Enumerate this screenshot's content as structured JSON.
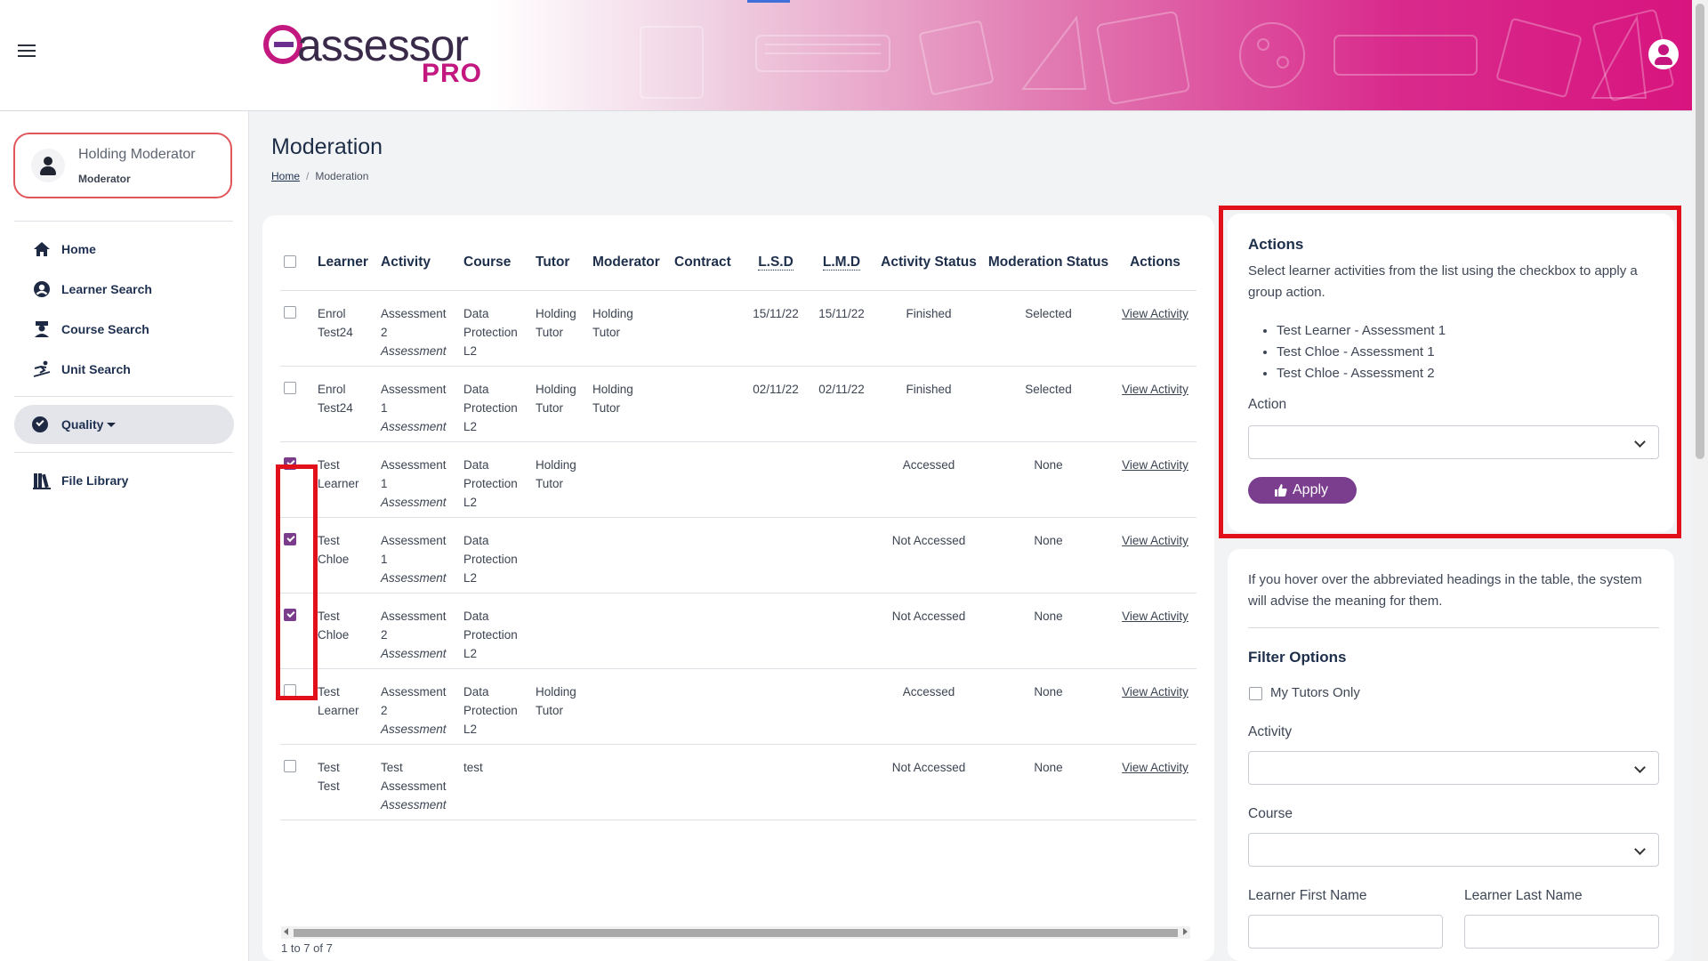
{
  "header": {
    "logo_main": "assessor",
    "logo_sub": "PRO"
  },
  "sidebar": {
    "profile": {
      "name": "Holding Moderator",
      "role": "Moderator"
    },
    "items": [
      {
        "label": "Home",
        "icon": "home-icon"
      },
      {
        "label": "Learner Search",
        "icon": "user-circle-icon"
      },
      {
        "label": "Course Search",
        "icon": "graduate-icon"
      },
      {
        "label": "Unit Search",
        "icon": "skier-icon"
      }
    ],
    "quality": {
      "label": "Quality",
      "icon": "check-circle-icon"
    },
    "file_library": {
      "label": "File Library",
      "icon": "books-icon"
    }
  },
  "page": {
    "title": "Moderation",
    "breadcrumb": {
      "home": "Home",
      "current": "Moderation"
    }
  },
  "table": {
    "headers": [
      "Learner",
      "Activity",
      "Course",
      "Tutor",
      "Moderator",
      "Contract",
      "L.S.D",
      "L.M.D",
      "Activity Status",
      "Moderation Status",
      "Actions"
    ],
    "rows": [
      {
        "checked": false,
        "learner": [
          "Enrol",
          "Test24"
        ],
        "activity": [
          "Assessment",
          "2"
        ],
        "activity_type": "Assessment",
        "course": [
          "Data",
          "Protection",
          "L2"
        ],
        "tutor": [
          "Holding",
          "Tutor"
        ],
        "moderator": [
          "Holding",
          "Tutor"
        ],
        "contract": "",
        "lsd": "15/11/22",
        "lmd": "15/11/22",
        "activity_status": "Finished",
        "moderation_status": "Selected",
        "action": "View Activity"
      },
      {
        "checked": false,
        "learner": [
          "Enrol",
          "Test24"
        ],
        "activity": [
          "Assessment",
          "1"
        ],
        "activity_type": "Assessment",
        "course": [
          "Data",
          "Protection",
          "L2"
        ],
        "tutor": [
          "Holding",
          "Tutor"
        ],
        "moderator": [
          "Holding",
          "Tutor"
        ],
        "contract": "",
        "lsd": "02/11/22",
        "lmd": "02/11/22",
        "activity_status": "Finished",
        "moderation_status": "Selected",
        "action": "View Activity"
      },
      {
        "checked": true,
        "learner": [
          "Test",
          "Learner"
        ],
        "activity": [
          "Assessment",
          "1"
        ],
        "activity_type": "Assessment",
        "course": [
          "Data",
          "Protection",
          "L2"
        ],
        "tutor": [
          "Holding",
          "Tutor"
        ],
        "moderator": [
          "",
          ""
        ],
        "contract": "",
        "lsd": "",
        "lmd": "",
        "activity_status": "Accessed",
        "moderation_status": "None",
        "action": "View Activity"
      },
      {
        "checked": true,
        "learner": [
          "Test",
          "Chloe"
        ],
        "activity": [
          "Assessment",
          "1"
        ],
        "activity_type": "Assessment",
        "course": [
          "Data",
          "Protection",
          "L2"
        ],
        "tutor": [
          "",
          ""
        ],
        "moderator": [
          "",
          ""
        ],
        "contract": "",
        "lsd": "",
        "lmd": "",
        "activity_status": "Not Accessed",
        "moderation_status": "None",
        "action": "View Activity"
      },
      {
        "checked": true,
        "learner": [
          "Test",
          "Chloe"
        ],
        "activity": [
          "Assessment",
          "2"
        ],
        "activity_type": "Assessment",
        "course": [
          "Data",
          "Protection",
          "L2"
        ],
        "tutor": [
          "",
          ""
        ],
        "moderator": [
          "",
          ""
        ],
        "contract": "",
        "lsd": "",
        "lmd": "",
        "activity_status": "Not Accessed",
        "moderation_status": "None",
        "action": "View Activity"
      },
      {
        "checked": false,
        "learner": [
          "Test",
          "Learner"
        ],
        "activity": [
          "Assessment",
          "2"
        ],
        "activity_type": "Assessment",
        "course": [
          "Data",
          "Protection",
          "L2"
        ],
        "tutor": [
          "Holding",
          "Tutor"
        ],
        "moderator": [
          "",
          ""
        ],
        "contract": "",
        "lsd": "",
        "lmd": "",
        "activity_status": "Accessed",
        "moderation_status": "None",
        "action": "View Activity"
      },
      {
        "checked": false,
        "learner": [
          "Test",
          "Test"
        ],
        "activity": [
          "Test",
          "Assessment"
        ],
        "activity_type": "Assessment",
        "course": [
          "test",
          "",
          ""
        ],
        "tutor": [
          "",
          ""
        ],
        "moderator": [
          "",
          ""
        ],
        "contract": "",
        "lsd": "",
        "lmd": "",
        "activity_status": "Not Accessed",
        "moderation_status": "None",
        "action": "View Activity"
      }
    ],
    "pager": "1 to 7 of 7"
  },
  "actions_panel": {
    "title": "Actions",
    "description": "Select learner activities from the list using the checkbox to apply a group action.",
    "selected": [
      "Test Learner - Assessment 1",
      "Test Chloe - Assessment 1",
      "Test Chloe - Assessment 2"
    ],
    "action_label": "Action",
    "action_value": "",
    "apply_label": "Apply"
  },
  "filter_panel": {
    "hint": "If you hover over the abbreviated headings in the table, the system will advise the meaning for them.",
    "title": "Filter Options",
    "my_tutors_only": "My Tutors Only",
    "my_tutors_only_checked": false,
    "activity_label": "Activity",
    "course_label": "Course",
    "first_name_label": "Learner First Name",
    "last_name_label": "Learner Last Name"
  },
  "colors": {
    "accent": "#7b3c8c",
    "brand_pink": "#c2187f",
    "highlight_red": "#e1101b"
  }
}
